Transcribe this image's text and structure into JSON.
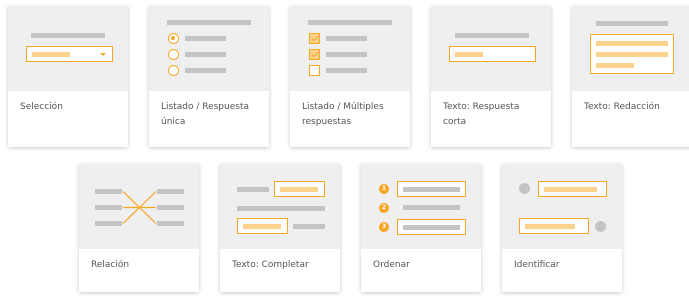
{
  "question_types": [
    {
      "label": "Selección",
      "icon": "dropdown-select-icon"
    },
    {
      "label": "Listado / Respuesta única",
      "icon": "radio-list-icon"
    },
    {
      "label": "Listado / Múltiples respuestas",
      "icon": "checkbox-list-icon"
    },
    {
      "label": "Texto: Respuesta corta",
      "icon": "short-text-input-icon"
    },
    {
      "label": "Texto: Redacción",
      "icon": "long-text-area-icon"
    },
    {
      "label": "Relación",
      "icon": "matching-lines-icon"
    },
    {
      "label": "Texto: Completar",
      "icon": "fill-in-blanks-icon"
    },
    {
      "label": "Ordenar",
      "icon": "numbered-order-icon"
    },
    {
      "label": "Identificar",
      "icon": "identify-points-icon"
    }
  ],
  "numbers": [
    "1",
    "2",
    "3"
  ],
  "colors": {
    "accent": "#f5a623",
    "accent_light": "#fbd38d",
    "placeholder_gray": "#c4c4c4",
    "thumb_bg": "#efefef",
    "label_text": "#555555"
  }
}
